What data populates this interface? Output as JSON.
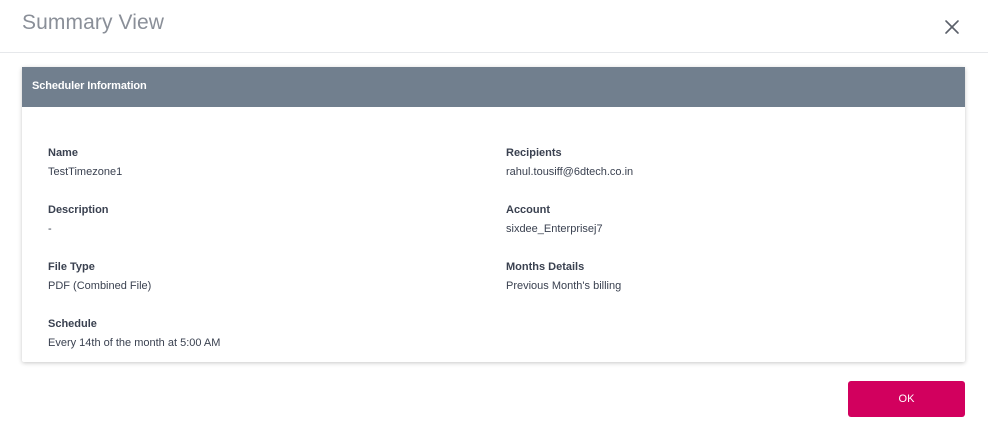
{
  "modal": {
    "title": "Summary View",
    "close_icon": "close-icon"
  },
  "section": {
    "title": "Scheduler Information",
    "header_color": "#717f8e"
  },
  "fields": {
    "name": {
      "label": "Name",
      "value": "TestTimezone1"
    },
    "recipients": {
      "label": "Recipients",
      "value": "rahul.tousiff@6dtech.co.in"
    },
    "description": {
      "label": "Description",
      "value": "-"
    },
    "account": {
      "label": "Account",
      "value": "sixdee_Enterprisej7"
    },
    "file_type": {
      "label": "File Type",
      "value": "PDF (Combined File)"
    },
    "months_details": {
      "label": "Months Details",
      "value": "Previous Month's billing"
    },
    "schedule": {
      "label": "Schedule",
      "value": "Every 14th of the month at 5:00 AM"
    }
  },
  "footer": {
    "ok_label": "OK",
    "ok_color": "#d2005e"
  }
}
